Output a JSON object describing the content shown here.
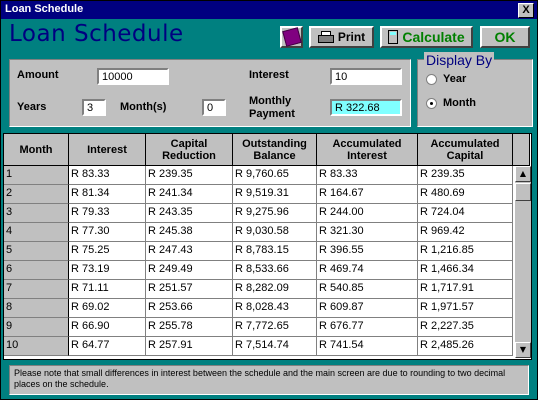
{
  "window": {
    "title": "Loan Schedule",
    "close_label": "X"
  },
  "header": {
    "title": "Loan Schedule",
    "print_label": "Print",
    "calculate_label": "Calculate",
    "ok_label": "OK"
  },
  "form": {
    "amount_label": "Amount",
    "amount_value": "10000",
    "years_label": "Years",
    "years_value": "3",
    "months_label": "Month(s)",
    "months_value": "0",
    "interest_label": "Interest",
    "interest_value": "10",
    "monthly_payment_label_1": "Monthly",
    "monthly_payment_label_2": "Payment",
    "monthly_payment_value": "R 322.68"
  },
  "display_by": {
    "legend": "Display By",
    "options": [
      "Year",
      "Month"
    ],
    "selected": "Month"
  },
  "table": {
    "headers": [
      [
        "Month",
        ""
      ],
      [
        "Interest",
        ""
      ],
      [
        "Capital",
        "Reduction"
      ],
      [
        "Outstanding",
        "Balance"
      ],
      [
        "Accumulated",
        "Interest"
      ],
      [
        "Accumulated",
        "Capital"
      ]
    ],
    "rows": [
      [
        "1",
        "R 83.33",
        "R 239.35",
        "R 9,760.65",
        "R 83.33",
        "R 239.35"
      ],
      [
        "2",
        "R 81.34",
        "R 241.34",
        "R 9,519.31",
        "R 164.67",
        "R 480.69"
      ],
      [
        "3",
        "R 79.33",
        "R 243.35",
        "R 9,275.96",
        "R 244.00",
        "R 724.04"
      ],
      [
        "4",
        "R 77.30",
        "R 245.38",
        "R 9,030.58",
        "R 321.30",
        "R 969.42"
      ],
      [
        "5",
        "R 75.25",
        "R 247.43",
        "R 8,783.15",
        "R 396.55",
        "R 1,216.85"
      ],
      [
        "6",
        "R 73.19",
        "R 249.49",
        "R 8,533.66",
        "R 469.74",
        "R 1,466.34"
      ],
      [
        "7",
        "R 71.11",
        "R 251.57",
        "R 8,282.09",
        "R 540.85",
        "R 1,717.91"
      ],
      [
        "8",
        "R 69.02",
        "R 253.66",
        "R 8,028.43",
        "R 609.87",
        "R 1,971.57"
      ],
      [
        "9",
        "R 66.90",
        "R 255.78",
        "R 7,772.65",
        "R 676.77",
        "R 2,227.35"
      ],
      [
        "10",
        "R 64.77",
        "R 257.91",
        "R 7,514.74",
        "R 741.54",
        "R 2,485.26"
      ]
    ]
  },
  "note": "Please note that small differences in interest between the schedule and the main screen are due to rounding to two decimal places on the schedule."
}
